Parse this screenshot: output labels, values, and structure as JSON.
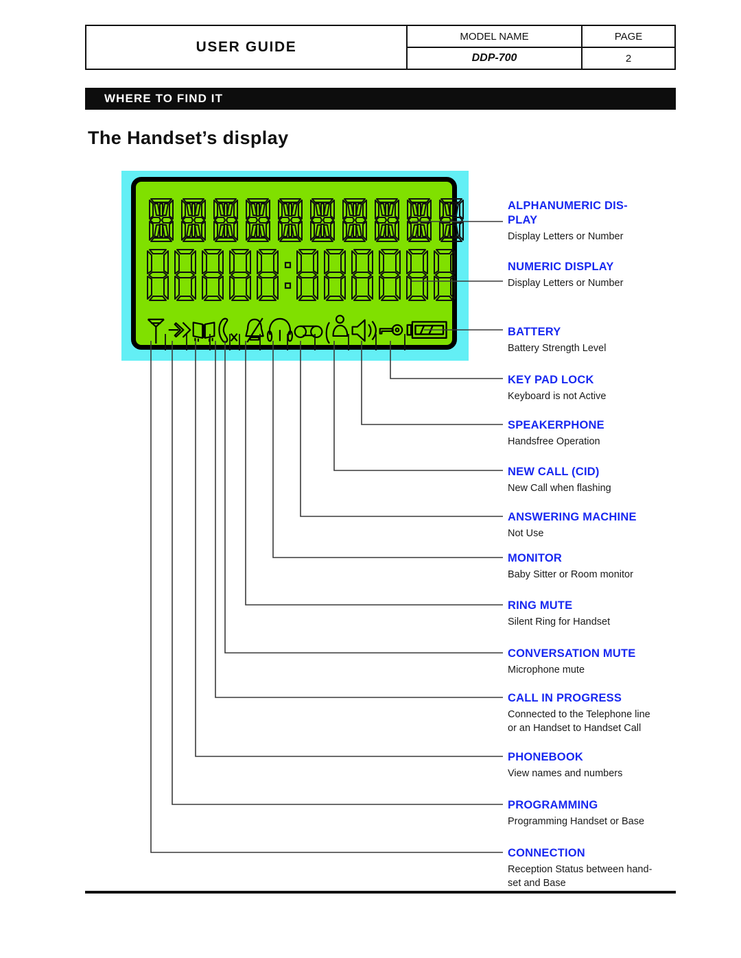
{
  "header": {
    "guide_title": "USER GUIDE",
    "model_label": "MODEL NAME",
    "page_label": "PAGE",
    "model_value": "DDP-700",
    "page_value": "2"
  },
  "banner": {
    "text": "WHERE TO FIND IT"
  },
  "section": {
    "title": "The Handset’s display"
  },
  "lcd": {
    "alpha_char_count": 10,
    "numeric_digit_count": 11,
    "colon_after_digit": 5,
    "background_color": "#80E000",
    "bezel_color": "#63EFF5",
    "border_color": "#000000",
    "icons": [
      {
        "name": "antenna-icon",
        "label": "CONNECTION"
      },
      {
        "name": "programming-arrows-icon",
        "label": "PROGRAMMING"
      },
      {
        "name": "phonebook-icon",
        "label": "PHONEBOOK"
      },
      {
        "name": "handset-call-icon",
        "label": "CALL IN PROGRESS"
      },
      {
        "name": "conversation-mute-icon",
        "label": "CONVERSATION MUTE"
      },
      {
        "name": "ring-mute-bell-icon",
        "label": "RING MUTE"
      },
      {
        "name": "monitor-headphones-icon",
        "label": "MONITOR"
      },
      {
        "name": "answering-machine-cassette-icon",
        "label": "ANSWERING MACHINE"
      },
      {
        "name": "new-call-person-icon",
        "label": "NEW CALL (CID)"
      },
      {
        "name": "speakerphone-icon",
        "label": "SPEAKERPHONE"
      },
      {
        "name": "keypad-lock-key-icon",
        "label": "KEY PAD LOCK"
      },
      {
        "name": "battery-icon",
        "label": "BATTERY"
      }
    ]
  },
  "callouts": [
    {
      "title": "ALPHANUMERIC DIS-",
      "title2": "PLAY",
      "desc": "Display Letters or Number"
    },
    {
      "title": "NUMERIC DISPLAY",
      "desc": "Display Letters or Number"
    },
    {
      "title": "BATTERY",
      "desc": "Battery Strength Level"
    },
    {
      "title": "KEY PAD LOCK",
      "desc": "Keyboard is not Active"
    },
    {
      "title": "SPEAKERPHONE",
      "desc": "Handsfree Operation"
    },
    {
      "title": "NEW CALL (CID)",
      "desc": "New Call when flashing"
    },
    {
      "title": "ANSWERING MACHINE",
      "desc": "Not Use"
    },
    {
      "title": "MONITOR",
      "desc": "Baby Sitter or Room monitor"
    },
    {
      "title": "RING MUTE",
      "desc": "Silent Ring for Handset"
    },
    {
      "title": "CONVERSATION MUTE",
      "desc": "Microphone mute"
    },
    {
      "title": "CALL IN PROGRESS",
      "desc": "Connected to the Telephone line\nor an Handset to Handset Call"
    },
    {
      "title": "PHONEBOOK",
      "desc": "View names and numbers"
    },
    {
      "title": "PROGRAMMING",
      "desc": "Programming Handset or Base"
    },
    {
      "title": "CONNECTION",
      "desc": "Reception Status between hand-\nset and Base"
    }
  ],
  "colors": {
    "accent_blue": "#1828F0",
    "banner_bg": "#0d0d0d",
    "text": "#1a1a1a"
  }
}
